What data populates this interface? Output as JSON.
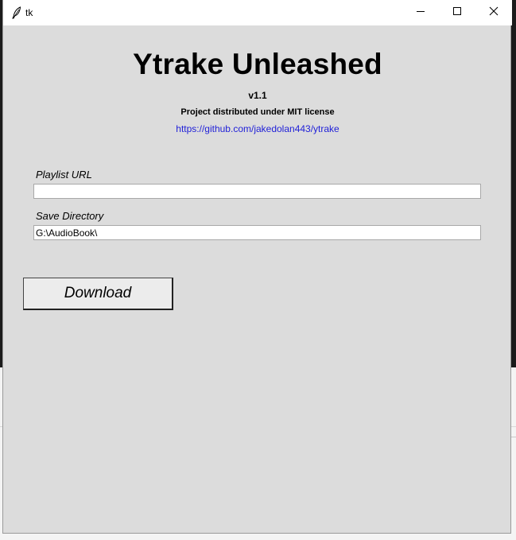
{
  "window": {
    "title": "tk",
    "controls": {
      "minimize_icon": "minimize-icon",
      "maximize_icon": "maximize-icon",
      "close_icon": "close-icon"
    }
  },
  "header": {
    "title": "Ytrake Unleashed",
    "version": "v1.1",
    "license": "Project distributed under MIT license",
    "link": "https://github.com/jakedolan443/ytrake"
  },
  "form": {
    "playlist_label": "Playlist URL",
    "playlist_value": "",
    "directory_label": "Save Directory",
    "directory_value": "G:\\AudioBook\\"
  },
  "actions": {
    "download_label": "Download"
  },
  "colors": {
    "window_bg": "#dcdcdc",
    "link": "#1f1fd8"
  }
}
